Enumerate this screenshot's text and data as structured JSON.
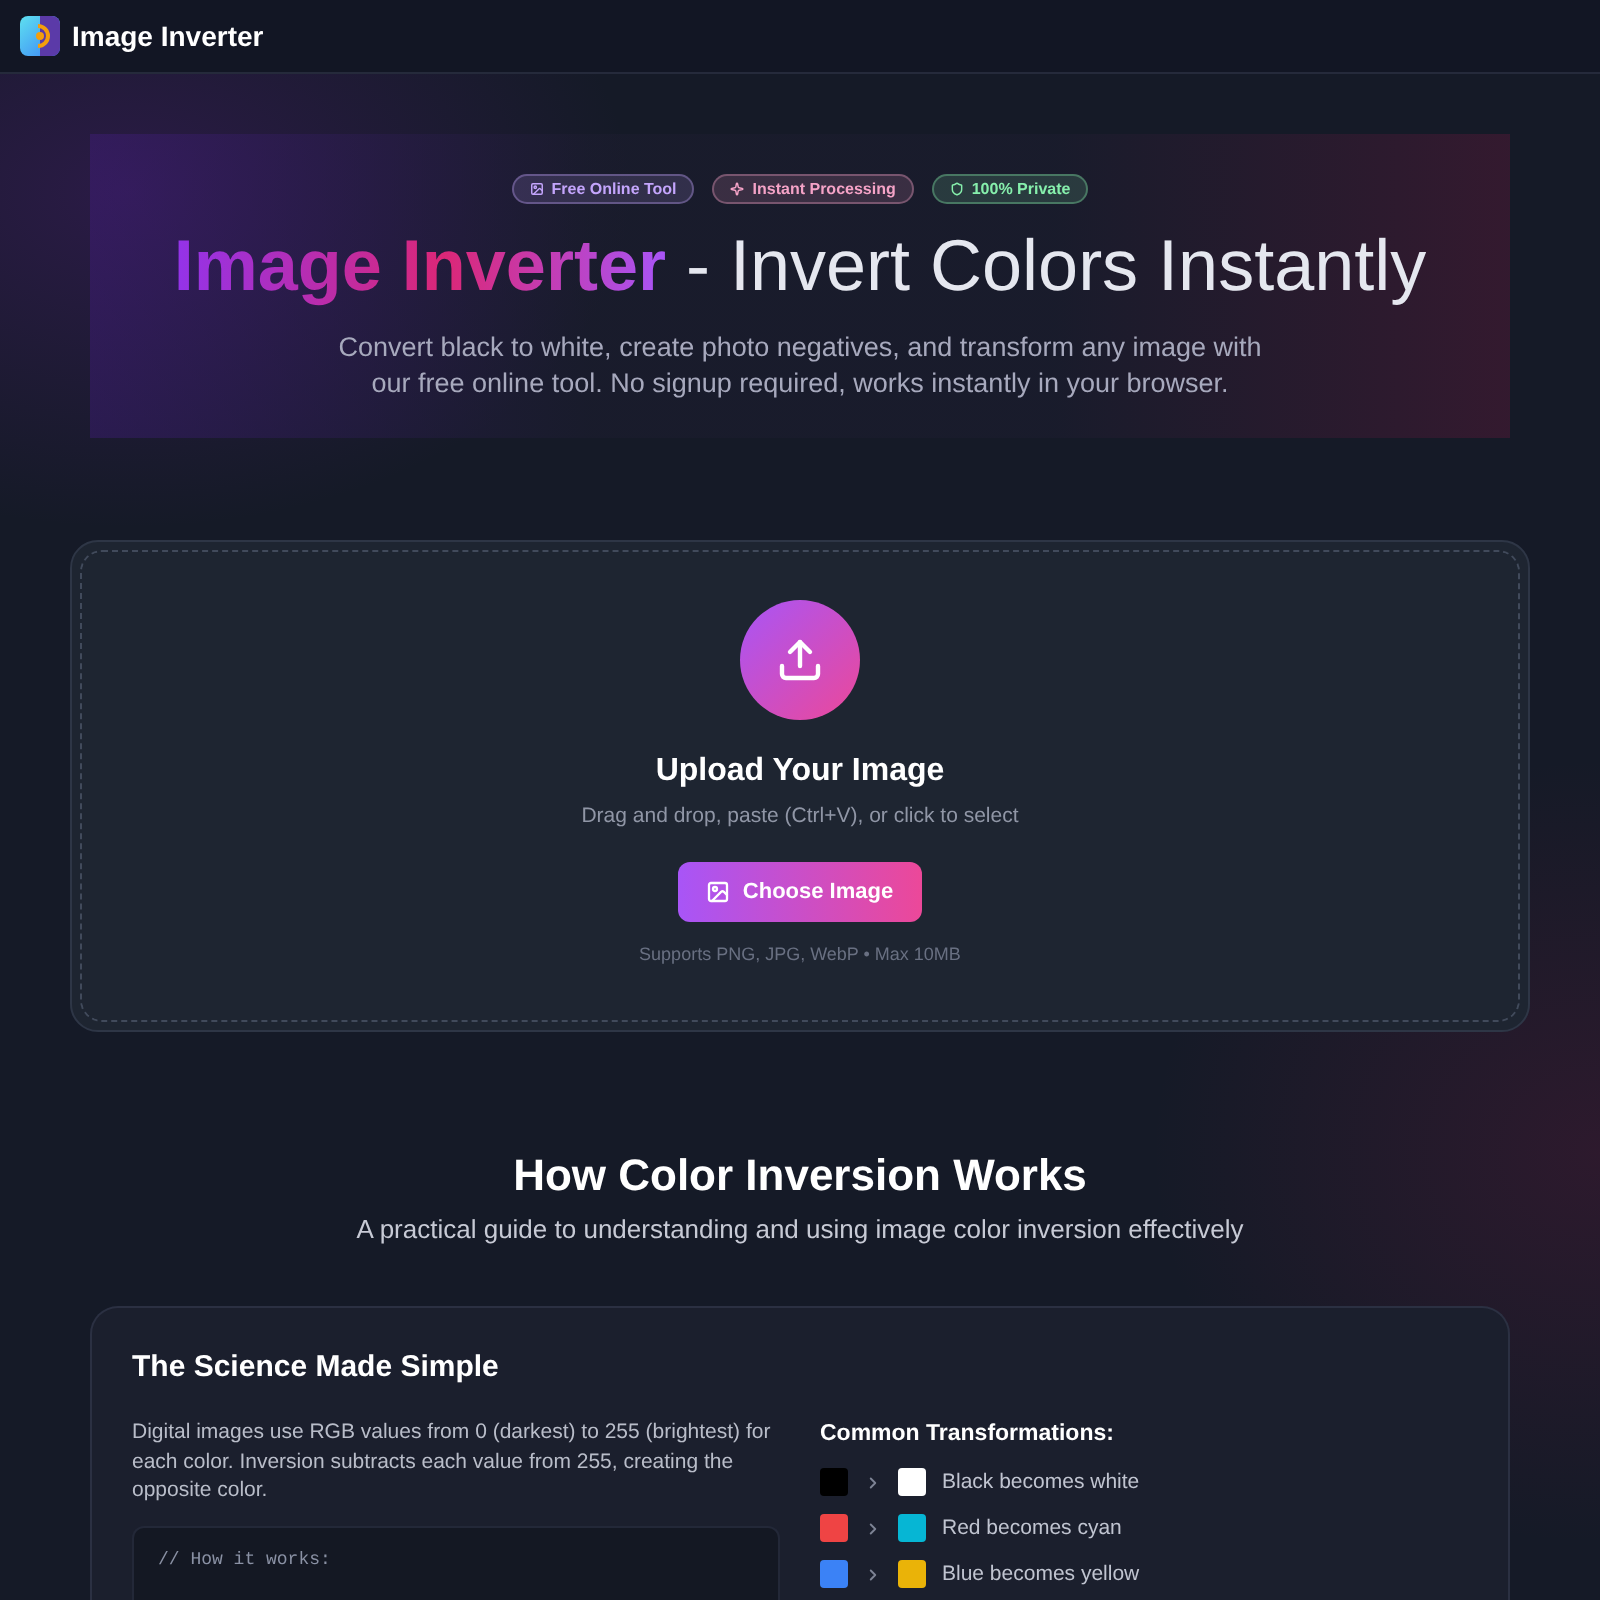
{
  "header": {
    "title": "Image Inverter"
  },
  "hero": {
    "badges": [
      {
        "kind": "tool",
        "label": "Free Online Tool",
        "color": "#c4a5fc"
      },
      {
        "kind": "instant",
        "label": "Instant Processing",
        "color": "#f5a3c7"
      },
      {
        "kind": "private",
        "label": "100% Private",
        "color": "#86efac"
      }
    ],
    "title": {
      "highlight": "Image Inverter",
      "rest": "- Invert Colors Instantly"
    },
    "subtitle": "Convert black to white, create photo negatives, and transform any image with our free online tool. No signup required, works instantly in your browser."
  },
  "upload": {
    "title": "Upload Your Image",
    "hint": "Drag and drop, paste (Ctrl+V), or click to select",
    "button": "Choose Image",
    "note": "Supports PNG, JPG, WebP • Max 10MB"
  },
  "guide": {
    "title": "How Color Inversion Works",
    "subtitle": "A practical guide to understanding and using image color inversion effectively"
  },
  "science": {
    "title": "The Science Made Simple",
    "text": "Digital images use RGB values from 0 (darkest) to 255 (brightest) for each color. Inversion subtracts each value from 255, creating the opposite color.",
    "code": [
      "// How it works:"
    ],
    "transformations": {
      "title": "Common Transformations:",
      "items": [
        {
          "swatches": [
            {
              "color": "#000000"
            },
            {
              "color": "#ffffff"
            }
          ],
          "label": "Black becomes white"
        },
        {
          "swatches": [
            {
              "color": "#ef4444"
            },
            {
              "color": "#06b6d4"
            }
          ],
          "label": "Red becomes cyan"
        },
        {
          "swatches": [
            {
              "color": "#3b82f6"
            },
            {
              "color": "#eab308"
            }
          ],
          "label": "Blue becomes yellow"
        }
      ]
    }
  }
}
